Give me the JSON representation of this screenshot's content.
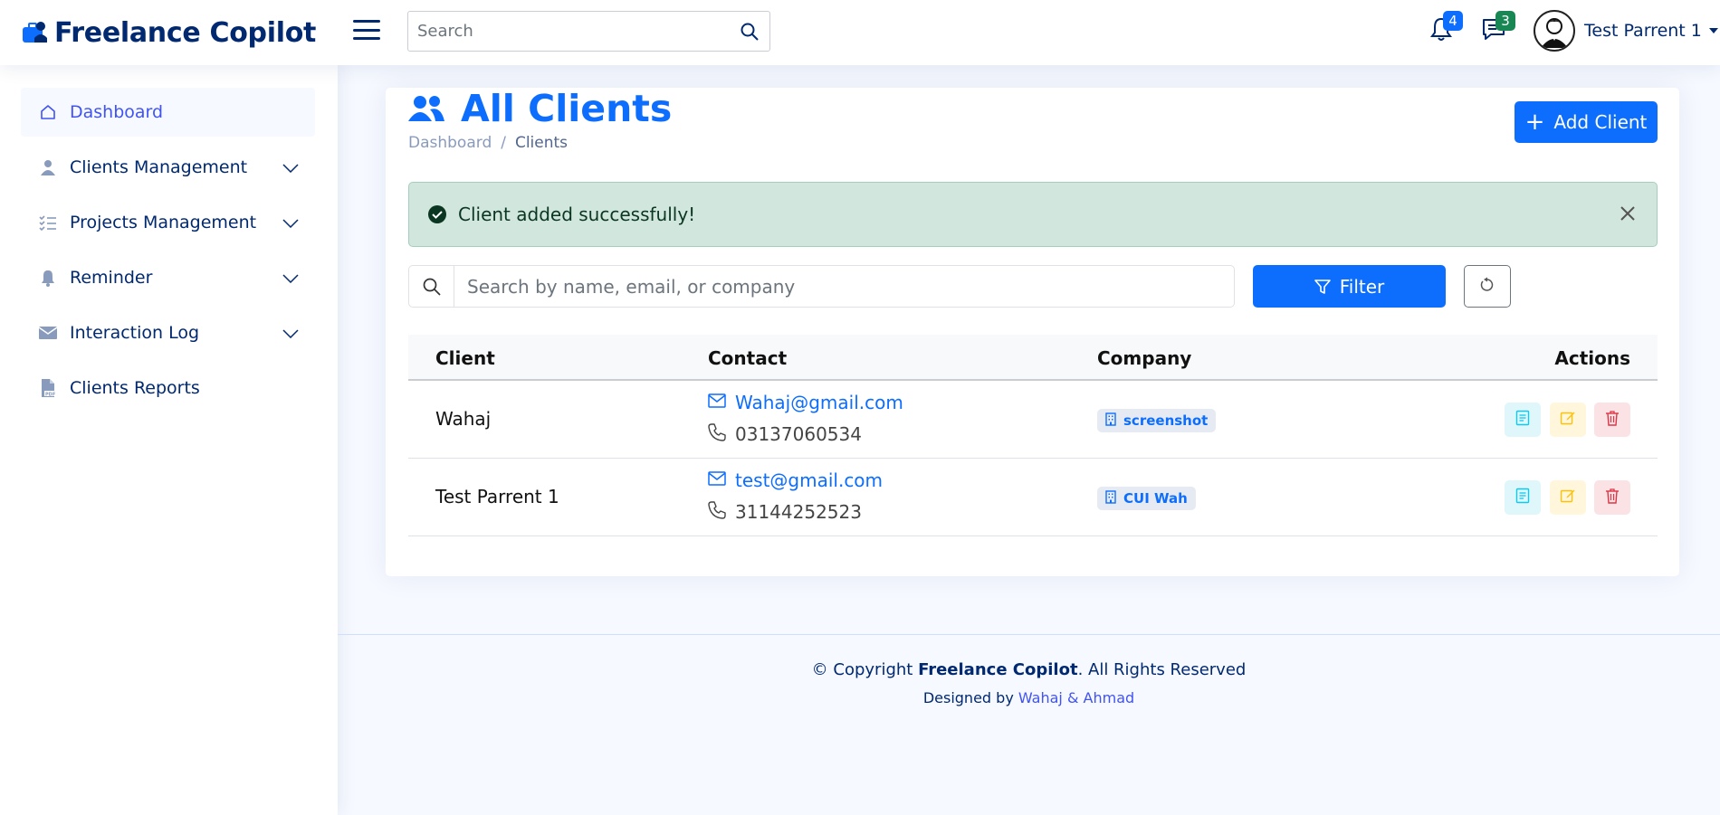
{
  "header": {
    "app_name": "Freelance Copilot",
    "search_placeholder": "Search",
    "notifications_count": "4",
    "messages_count": "3",
    "user_name": "Test Parrent 1"
  },
  "sidebar": {
    "items": [
      {
        "label": "Dashboard",
        "icon": "house-icon",
        "active": true
      },
      {
        "label": "Clients Management",
        "icon": "person-icon",
        "expandable": true
      },
      {
        "label": "Projects Management",
        "icon": "list-check-icon",
        "expandable": true
      },
      {
        "label": "Reminder",
        "icon": "bell-icon",
        "expandable": true
      },
      {
        "label": "Interaction Log",
        "icon": "envelope-icon",
        "expandable": true
      },
      {
        "label": "Clients Reports",
        "icon": "pdf-file-icon"
      }
    ]
  },
  "page": {
    "title": "All Clients",
    "breadcrumb": [
      "Dashboard",
      "Clients"
    ],
    "add_button": "Add Client"
  },
  "alert": {
    "message": "Client added successfully!",
    "type": "success"
  },
  "filters": {
    "search_placeholder": "Search by name, email, or company",
    "filter_button": "Filter"
  },
  "table": {
    "columns": [
      "Client",
      "Contact",
      "Company",
      "Actions"
    ],
    "rows": [
      {
        "client": "Wahaj",
        "email": "Wahaj@gmail.com",
        "phone": "03137060534",
        "company": "screenshot"
      },
      {
        "client": "Test Parrent 1",
        "email": "test@gmail.com",
        "phone": "31144252523",
        "company": "CUI Wah"
      }
    ]
  },
  "footer": {
    "copyright_prefix": "© Copyright ",
    "copyright_brand": "Freelance Copilot",
    "copyright_suffix": ". All Rights Reserved",
    "designed_prefix": "Designed by ",
    "designed_by": "Wahaj & Ahmad"
  },
  "colors": {
    "primary": "#0d6efd",
    "navy": "#012970",
    "success_bg": "#d1e7dd",
    "sidebar_active": "#4154f1"
  }
}
